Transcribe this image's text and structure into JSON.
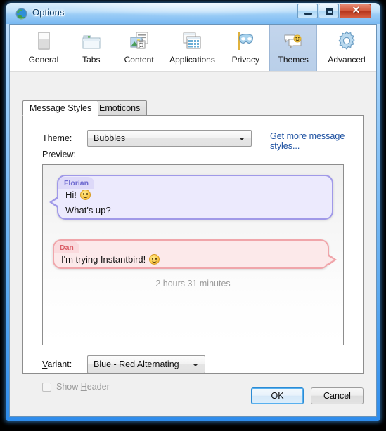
{
  "window": {
    "title": "Options",
    "icon": "globe-icon",
    "buttons": {
      "minimize": "minimize-icon",
      "maximize": "maximize-icon",
      "close": "✕"
    }
  },
  "toolbar": {
    "items": [
      {
        "label": "General",
        "icon": "window-pane-icon",
        "selected": false
      },
      {
        "label": "Tabs",
        "icon": "folder-tabs-icon",
        "selected": false
      },
      {
        "label": "Content",
        "icon": "image-text-icon",
        "selected": false
      },
      {
        "label": "Applications",
        "icon": "app-windows-icon",
        "selected": false
      },
      {
        "label": "Privacy",
        "icon": "mask-icon",
        "selected": false
      },
      {
        "label": "Themes",
        "icon": "chat-smiley-icon",
        "selected": true
      },
      {
        "label": "Advanced",
        "icon": "gear-icon",
        "selected": false
      }
    ]
  },
  "tabs": [
    {
      "label": "Message Styles",
      "active": true
    },
    {
      "label": "Emoticons",
      "active": false
    }
  ],
  "panel": {
    "theme": {
      "label_prefix": "T",
      "label_rest": "heme:",
      "value": "Bubbles",
      "options": [
        "Bubbles"
      ]
    },
    "get_more_link": "Get more message styles...",
    "preview_label": "Preview:",
    "preview": {
      "messages": [
        {
          "sender": "Florian",
          "side": "left",
          "lines": [
            "Hi!",
            "What's up?"
          ],
          "emoji_on_line": 0,
          "emoji": "smiley-icon",
          "border_color": "#a099e8",
          "background": "#eceafd",
          "header_background": "#ddd9f9",
          "sender_color": "#6f6bd0"
        },
        {
          "sender": "Dan",
          "side": "right",
          "lines": [
            "I'm trying Instantbird!"
          ],
          "emoji_on_line": 0,
          "emoji": "smiley-icon",
          "border_color": "#f0a5aa",
          "background": "#fce9ea",
          "header_background": "#fadadd",
          "sender_color": "#db5f68"
        }
      ],
      "status": "2 hours 31 minutes"
    },
    "variant": {
      "label_prefix": "V",
      "label_rest": "ariant:",
      "value": "Blue - Red Alternating",
      "options": [
        "Blue - Red Alternating"
      ]
    },
    "show_header": {
      "label_before": "Show ",
      "label_accel": "H",
      "label_after": "eader",
      "checked": false,
      "enabled": false
    }
  },
  "dialog_buttons": {
    "ok": "OK",
    "cancel": "Cancel"
  }
}
